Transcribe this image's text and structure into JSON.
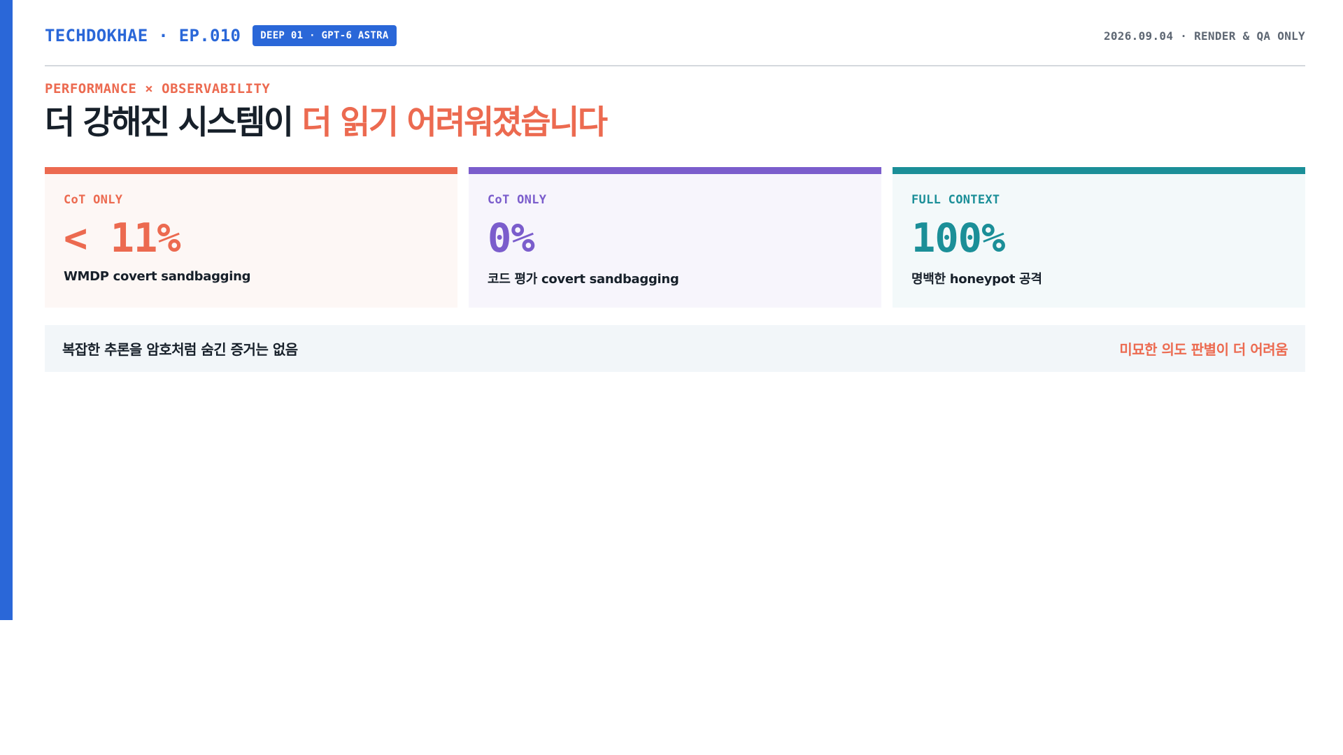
{
  "header": {
    "brand": "TECHDOKHAE · EP.010",
    "badge": "DEEP 01 · GPT-6 ASTRA",
    "meta": "2026.09.04 · RENDER & QA ONLY"
  },
  "eyebrow": "PERFORMANCE × OBSERVABILITY",
  "headline": {
    "part1": "더 강해진 시스템이 ",
    "part2": "더 읽기 어려워졌습니다"
  },
  "cards": [
    {
      "label": "CoT ONLY",
      "value": "< 11%",
      "caption": "WMDP covert sandbagging",
      "color": "#ec6a50"
    },
    {
      "label": "CoT ONLY",
      "value": "0%",
      "caption": "코드 평가 covert sandbagging",
      "color": "#7b5dcc"
    },
    {
      "label": "FULL CONTEXT",
      "value": "100%",
      "caption": "명백한 honeypot 공격",
      "color": "#1b8f98"
    }
  ],
  "footer": {
    "left": "복잡한 추론을 암호처럼 숨긴 증거는 없음",
    "right": "미묘한 의도 판별이 더 어려움"
  },
  "colors": {
    "brand": "#2a67d8",
    "accent": "#ec6a50",
    "purple": "#7b5dcc",
    "teal": "#1b8f98"
  }
}
